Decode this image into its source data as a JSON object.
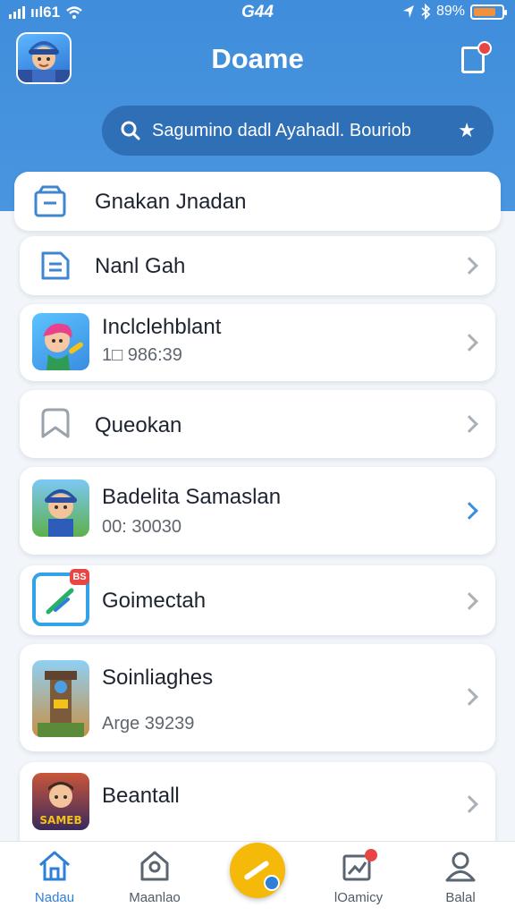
{
  "status_bar": {
    "signal": "ııl61",
    "time": "G44",
    "battery": "89%"
  },
  "header": {
    "title": "Doame"
  },
  "search": {
    "placeholder": "Sagumino dadl Ayahadl. Bouriob"
  },
  "items": [
    {
      "title": "Gnakan Jnadan",
      "subtitle": ""
    },
    {
      "title": "Nanl Gah",
      "subtitle": ""
    },
    {
      "title": "Inclclehblant",
      "subtitle": "1□ 986:39"
    },
    {
      "title": "Queokan",
      "subtitle": ""
    },
    {
      "title": "Badelita Samaslan",
      "subtitle": "00: 30030"
    },
    {
      "title": "Goimectah",
      "subtitle": ""
    },
    {
      "title": "Soinliaghes",
      "subtitle": "Arge 39239"
    },
    {
      "title": "Beantall",
      "subtitle": ""
    }
  ],
  "badges": {
    "goimectah": "BS",
    "beantall_thumb": "SAMEB"
  },
  "bottom_nav": [
    {
      "label": "Nadau"
    },
    {
      "label": "Maanlao"
    },
    {
      "label": "lOamicy"
    },
    {
      "label": "Balal"
    }
  ],
  "colors": {
    "accent": "#3f8ddb",
    "fab": "#f5b90a",
    "badge": "#e84545"
  }
}
